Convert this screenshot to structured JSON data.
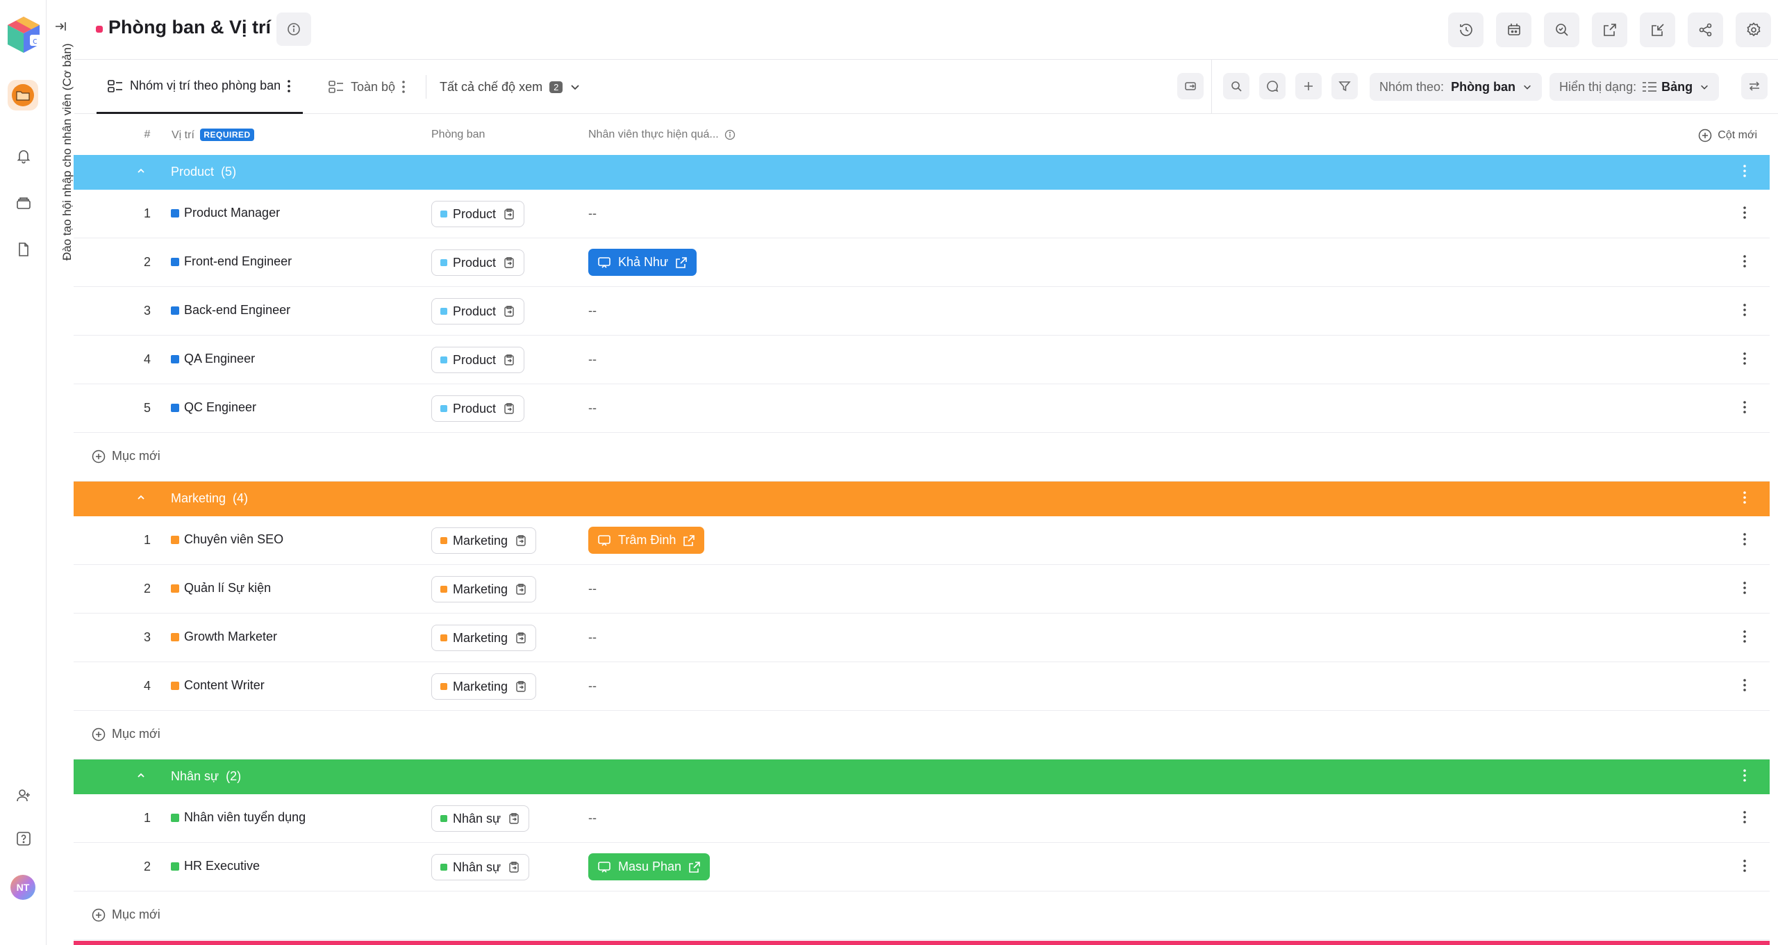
{
  "sidebar": {
    "icons": [
      "bell-icon",
      "inbox-icon",
      "document-icon",
      "add-person-icon",
      "help-icon"
    ],
    "avatar_initials": "NT"
  },
  "breadcrumb": {
    "vertical_text": "Đào tạo hội nhập cho nhân viên (Cơ bản)"
  },
  "header": {
    "title": "Phòng ban & Vị trí",
    "title_dot_color": "#f0336a",
    "actions": [
      "history-icon",
      "calendar-robot-icon",
      "search-zoom-icon",
      "export-icon",
      "import-icon",
      "share-icon",
      "settings-icon"
    ]
  },
  "tabs": {
    "items": [
      {
        "label": "Nhóm vị trí theo phòng ban",
        "active": true
      },
      {
        "label": "Toàn bộ",
        "active": false
      }
    ],
    "views_label": "Tất cả chế độ xem",
    "views_count": "2"
  },
  "toolbar": {
    "group_by_label": "Nhóm theo:",
    "group_by_value": "Phòng ban",
    "display_label": "Hiển thị dạng:",
    "display_value": "Bảng"
  },
  "table": {
    "columns": {
      "num": "#",
      "position": "Vị trí",
      "required_badge": "REQUIRED",
      "department": "Phòng ban",
      "employee": "Nhân viên thực hiện quá...",
      "new_column": "Cột mới"
    },
    "add_item_label": "Mục mới",
    "empty_value": "--",
    "groups": [
      {
        "name": "Product",
        "count": "(5)",
        "color": "#5ec5f5",
        "tag_color": "#5ec5f5",
        "row_color": "#1f7ae0",
        "rows": [
          {
            "num": "1",
            "position": "Product Manager",
            "department": "Product",
            "employee": ""
          },
          {
            "num": "2",
            "position": "Front-end Engineer",
            "department": "Product",
            "employee": "Khả Như"
          },
          {
            "num": "3",
            "position": "Back-end Engineer",
            "department": "Product",
            "employee": ""
          },
          {
            "num": "4",
            "position": "QA Engineer",
            "department": "Product",
            "employee": ""
          },
          {
            "num": "5",
            "position": "QC Engineer",
            "department": "Product",
            "employee": ""
          }
        ],
        "employee_color": "#1f7ae0"
      },
      {
        "name": "Marketing",
        "count": "(4)",
        "color": "#fc9627",
        "tag_color": "#fc9627",
        "row_color": "#fc9627",
        "rows": [
          {
            "num": "1",
            "position": "Chuyên viên SEO",
            "department": "Marketing",
            "employee": "Trâm Đinh"
          },
          {
            "num": "2",
            "position": "Quản lí Sự kiện",
            "department": "Marketing",
            "employee": ""
          },
          {
            "num": "3",
            "position": "Growth Marketer",
            "department": "Marketing",
            "employee": ""
          },
          {
            "num": "4",
            "position": "Content Writer",
            "department": "Marketing",
            "employee": ""
          }
        ],
        "employee_color": "#fc9627"
      },
      {
        "name": "Nhân sự",
        "count": "(2)",
        "color": "#3cc35a",
        "tag_color": "#3cc35a",
        "row_color": "#3cc35a",
        "rows": [
          {
            "num": "1",
            "position": "Nhân viên tuyển dụng",
            "department": "Nhân sự",
            "employee": ""
          },
          {
            "num": "2",
            "position": "HR Executive",
            "department": "Nhân sự",
            "employee": "Masu Phan"
          }
        ],
        "employee_color": "#3cc35a"
      }
    ]
  }
}
